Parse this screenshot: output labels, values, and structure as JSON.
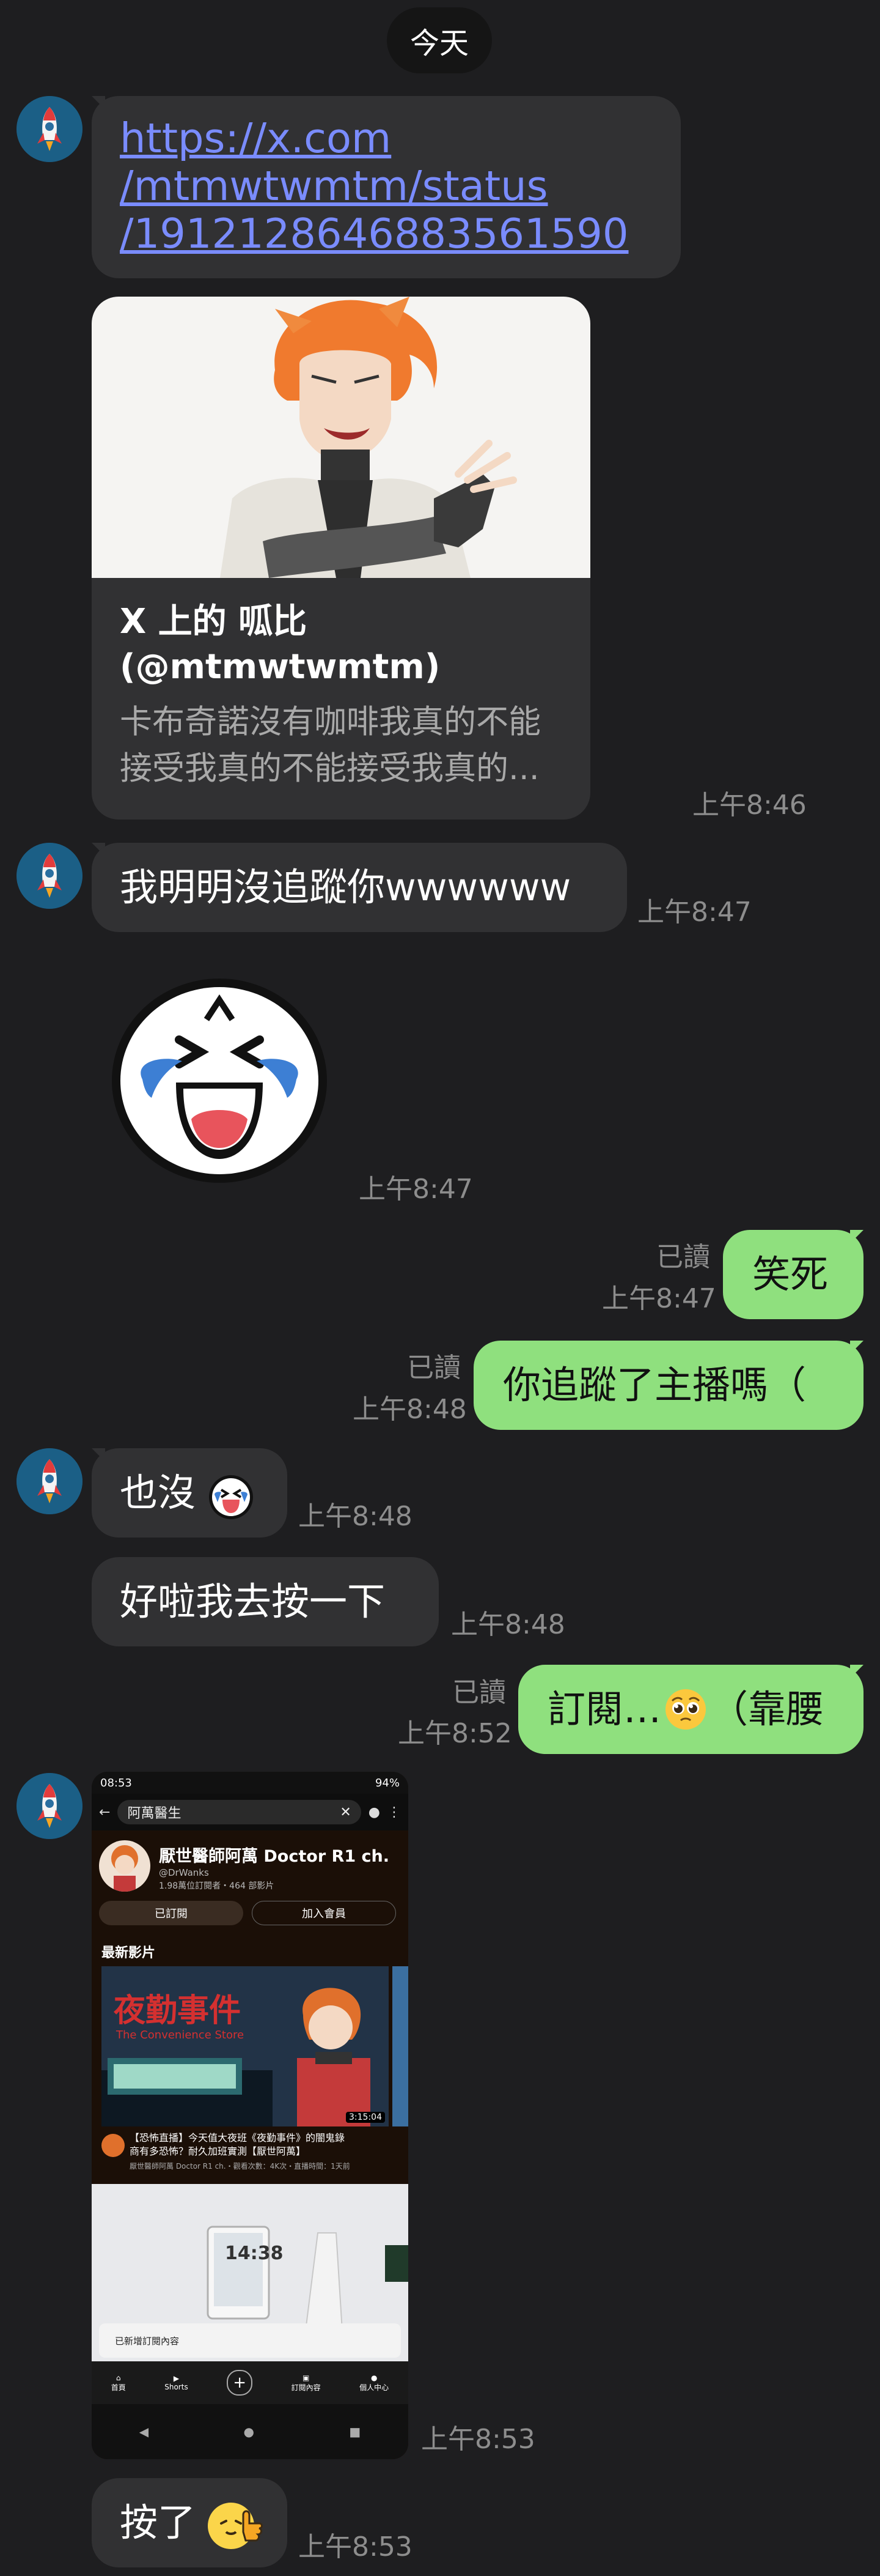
{
  "date_chip": "今天",
  "contact": {
    "avatar_icon": "rocket-icon"
  },
  "messages": [
    {
      "link": "https://x.com/mtmwtwmtm/status/1912128646883561590",
      "link_lines": [
        "https://x.com",
        "/mtmwtwmtm/status",
        "/1912128646883561590"
      ],
      "card": {
        "title_lines": [
          "X 上的 呱比",
          "(@mtmwtwmtm)"
        ],
        "desc_lines": [
          "卡布奇諾沒有咖啡我真的不能",
          "接受我真的不能接受我真的..."
        ]
      },
      "time": "上午8:46"
    },
    {
      "text": "我明明沒追蹤你wwwwww",
      "time": "上午8:47"
    },
    {
      "sticker": "laughing-crying-sticker",
      "time": "上午8:47"
    },
    {
      "text": "笑死",
      "read": "已讀",
      "time": "上午8:47"
    },
    {
      "text": "你追蹤了主播嗎（",
      "read": "已讀",
      "time": "上午8:48"
    },
    {
      "text": "也沒",
      "emoji": "crying-laugh-emoji",
      "time": "上午8:48"
    },
    {
      "text": "好啦我去按一下",
      "time": "上午8:48"
    },
    {
      "text": "訂閱…",
      "emoji": "pleading-face-emoji",
      "text_after": "（靠腰",
      "read": "已讀",
      "time": "上午8:52"
    },
    {
      "image": "youtube-channel-screenshot",
      "time": "上午8:53"
    },
    {
      "text": "按了",
      "emoji": "thumbs-up-sticker",
      "time": "上午8:53"
    }
  ],
  "screenshot": {
    "status_time": "08:53",
    "status_right": "94%",
    "search_query": "阿萬醫生",
    "channel_name": "厭世醫師阿萬 Doctor R1 ch.",
    "channel_handle": "@DrWanks",
    "channel_stats": "1.98萬位訂閱者・464 部影片",
    "subscribed_label": "已訂閱",
    "membership_label": "加入會員",
    "section_title": "最新影片",
    "thumb_title": "夜勤事件",
    "thumb_sub": "The Convenience Store",
    "thumb_duration": "3:15:04",
    "video_title_1": "【恐怖直播】今天值大夜班《夜勤事件》的闇鬼錄",
    "video_title_2": "商有多恐怖？耐久加班實測【厭世阿萬】",
    "video_meta": "厭世醫師阿萬 Doctor R1 ch.・觀看次數：4K次・直播時間：1天前",
    "clock_text": "14:38",
    "toast": "已新增訂閱內容",
    "nav": [
      "首頁",
      "Shorts",
      "",
      "訂閱內容",
      "個人中心"
    ]
  }
}
